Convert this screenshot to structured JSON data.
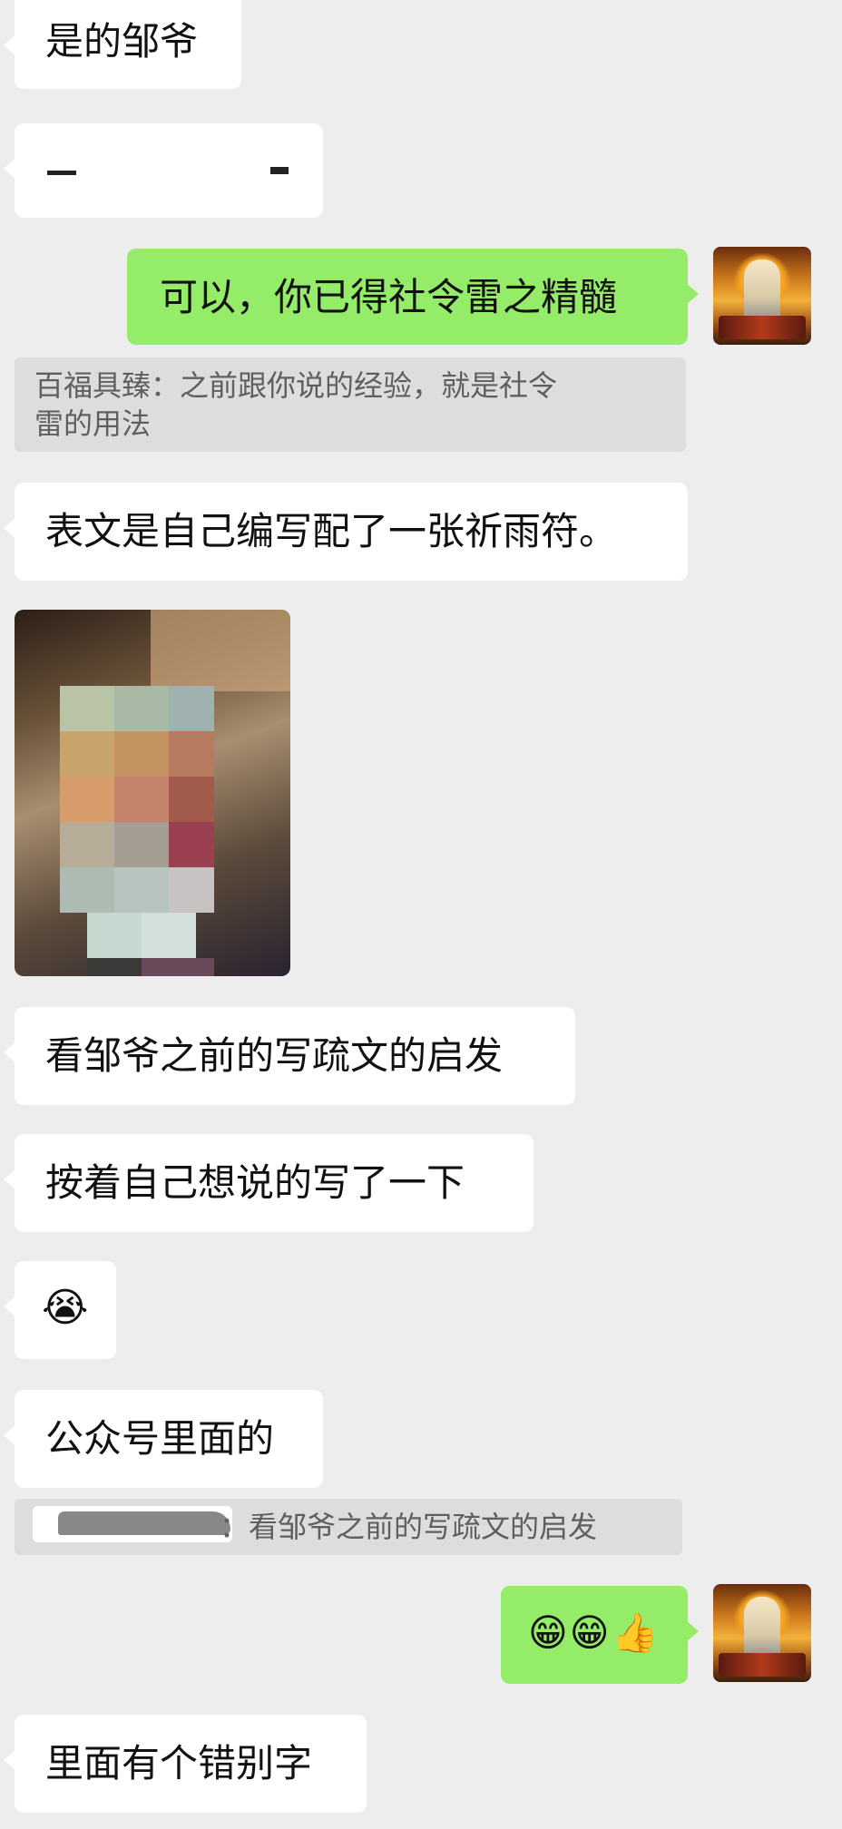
{
  "messages": {
    "m1": "是的邹爷",
    "m3": "可以，你已得社令雷之精髓",
    "q1": "百福具臻：之前跟你说的经验，就是社令雷的用法",
    "q1_line1": "百福具臻：之前跟你说的经验，就是社令",
    "q1_line2": "雷的用法",
    "m4": "表文是自己编写配了一张祈雨符。",
    "m5": "看邹爷之前的写疏文的启发",
    "m6": "按着自己想说的写了一下",
    "m7": "😭",
    "m8": "公众号里面的",
    "q2": "：看邹爷之前的写疏文的启发",
    "m9": "😁😁👍",
    "m10": "里面有个错别字"
  },
  "colors": {
    "background": "#ededed",
    "incoming_bubble": "#ffffff",
    "outgoing_bubble": "#95ec69",
    "quote_bg": "#dddddd",
    "quote_text": "#5f5f5f"
  },
  "icons": {
    "avatar": "deity-statue-avatar",
    "photo": "pixelated-photo"
  }
}
